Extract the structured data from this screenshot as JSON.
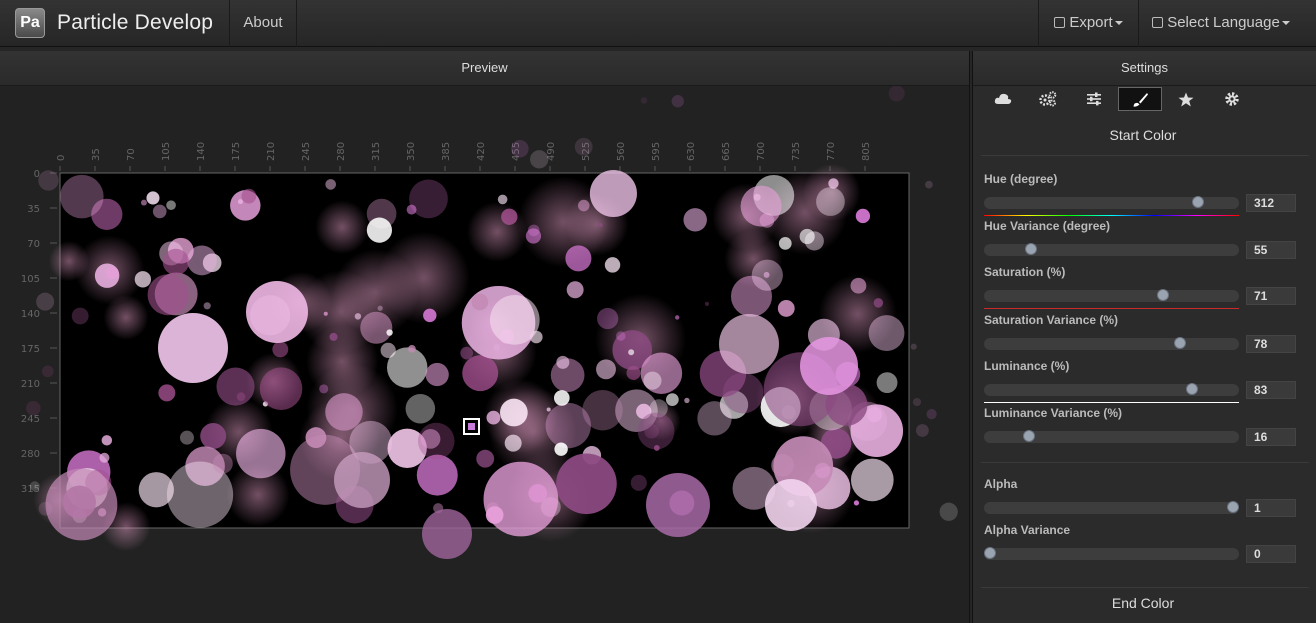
{
  "nav": {
    "logo_text": "Pa",
    "brand": "Particle Develop",
    "about": "About",
    "export": "Export",
    "language": "Select Language"
  },
  "preview": {
    "title": "Preview",
    "x_ticks": [
      "0",
      "35",
      "70",
      "105",
      "140",
      "175",
      "210",
      "245",
      "280",
      "315",
      "350",
      "385",
      "420",
      "455",
      "490",
      "525",
      "560",
      "595",
      "630",
      "665",
      "700",
      "735",
      "770",
      "805"
    ],
    "y_ticks": [
      "0",
      "35",
      "70",
      "105",
      "140",
      "175",
      "210",
      "245",
      "280",
      "315"
    ]
  },
  "settings": {
    "title": "Settings",
    "tabs": [
      {
        "icon": "cloud-icon"
      },
      {
        "icon": "gears-icon"
      },
      {
        "icon": "sliders-icon"
      },
      {
        "icon": "brush-icon",
        "active": true
      },
      {
        "icon": "star-icon"
      },
      {
        "icon": "gear-icon"
      }
    ],
    "start_color_title": "Start Color",
    "fields": [
      {
        "label": "Hue (degree)",
        "value": "312",
        "fraction": 0.855,
        "underline": "hue"
      },
      {
        "label": "Hue Variance (degree)",
        "value": "55",
        "fraction": 0.17
      },
      {
        "label": "Saturation (%)",
        "value": "71",
        "fraction": 0.71,
        "underline": "#cc2a2a"
      },
      {
        "label": "Saturation Variance (%)",
        "value": "78",
        "fraction": 0.78
      },
      {
        "label": "Luminance (%)",
        "value": "83",
        "fraction": 0.83,
        "underline": "#ffffff"
      },
      {
        "label": "Luminance Variance (%)",
        "value": "16",
        "fraction": 0.16
      }
    ],
    "alpha_fields": [
      {
        "label": "Alpha",
        "value": "1",
        "fraction": 1.0
      },
      {
        "label": "Alpha Variance",
        "value": "0",
        "fraction": 0.0
      }
    ],
    "end_color_title": "End Color"
  },
  "colors": {
    "accent": "#c87ad8",
    "panel_bg": "#2b2b2b",
    "stage_bg": "#000000"
  }
}
